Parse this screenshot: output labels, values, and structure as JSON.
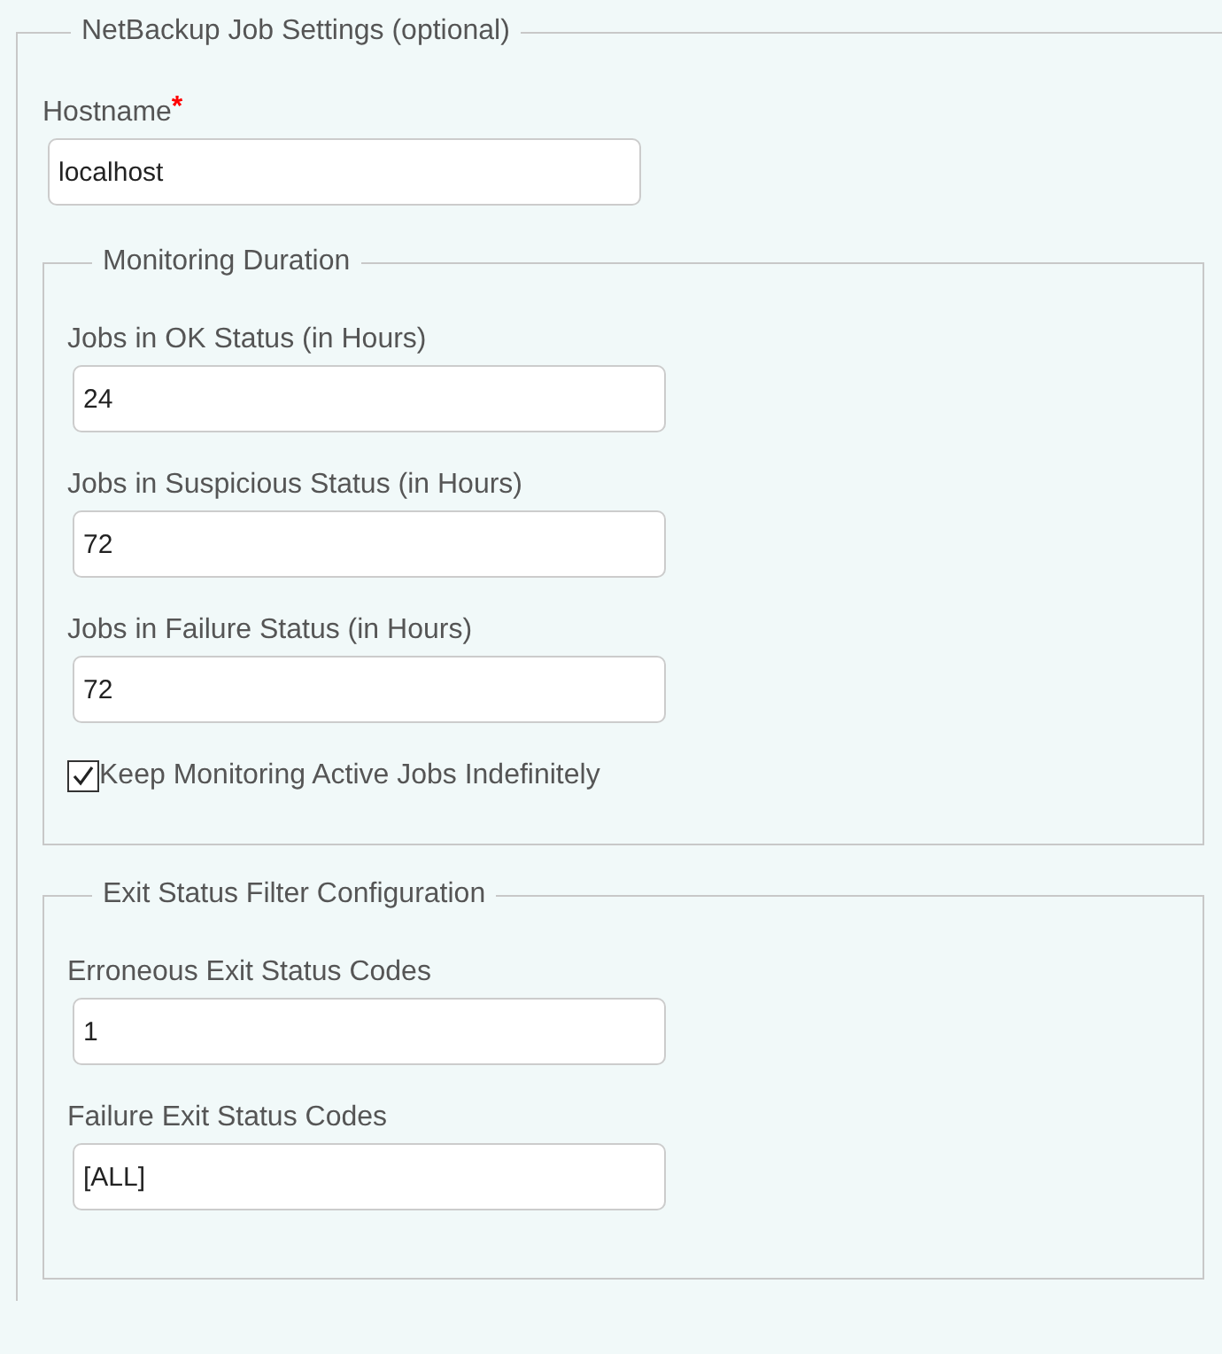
{
  "section": {
    "legend": "NetBackup Job Settings (optional)",
    "items": [
      {
        "kind": "field",
        "label": "Hostname",
        "required_mark": "*",
        "value": "localhost"
      }
    ],
    "groups": [
      {
        "legend": "Monitoring Duration",
        "items": [
          {
            "kind": "field",
            "label": "Jobs in OK Status (in Hours)",
            "value": "24"
          },
          {
            "kind": "field",
            "label": "Jobs in Suspicious Status (in Hours)",
            "value": "72"
          },
          {
            "kind": "field",
            "label": "Jobs in Failure Status (in Hours)",
            "value": "72"
          },
          {
            "kind": "checkbox",
            "label": "Keep Monitoring Active Jobs Indefinitely",
            "checked": true
          }
        ]
      },
      {
        "legend": "Exit Status Filter Configuration",
        "items": [
          {
            "kind": "field",
            "label": "Erroneous Exit Status Codes",
            "value": "1"
          },
          {
            "kind": "field",
            "label": "Failure Exit Status Codes",
            "value": "[ALL]"
          }
        ]
      }
    ]
  }
}
